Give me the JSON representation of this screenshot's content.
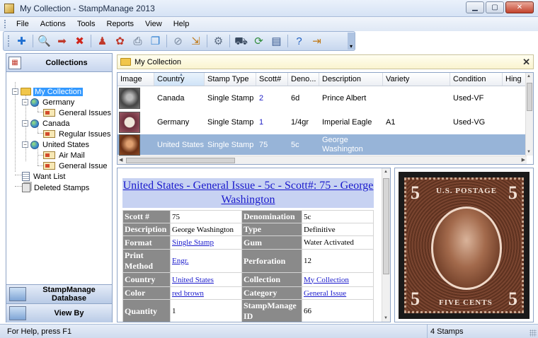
{
  "window": {
    "title": "My Collection - StampManage 2013"
  },
  "menu": [
    "File",
    "Actions",
    "Tools",
    "Reports",
    "View",
    "Help"
  ],
  "toolbar": {
    "buttons": [
      {
        "name": "add-stamp-icon",
        "glyph": "✚",
        "color": "#1f6fd1"
      },
      {
        "name": "find-icon",
        "glyph": "🔍",
        "color": "#b06b1a"
      },
      {
        "name": "export-icon",
        "glyph": "➡",
        "color": "#c0392b"
      },
      {
        "name": "delete-icon",
        "glyph": "✖",
        "color": "#d0251b"
      },
      {
        "name": "want-list-icon",
        "glyph": "♟",
        "color": "#c0392b"
      },
      {
        "name": "tools-icon",
        "glyph": "✿",
        "color": "#c0392b"
      },
      {
        "name": "print-icon",
        "glyph": "⎙",
        "color": "#4a5a70"
      },
      {
        "name": "copy-icon",
        "glyph": "❐",
        "color": "#2e7fd1"
      },
      {
        "name": "attach-icon",
        "glyph": "⊘",
        "color": "#7a8aa0"
      },
      {
        "name": "import-icon",
        "glyph": "⇲",
        "color": "#c07a1a"
      },
      {
        "name": "settings-icon",
        "glyph": "⚙",
        "color": "#5a6a80"
      },
      {
        "name": "cart-icon",
        "glyph": "⛟",
        "color": "#3a4a60"
      },
      {
        "name": "update-icon",
        "glyph": "⟳",
        "color": "#2e8b3a"
      },
      {
        "name": "report-icon",
        "glyph": "▤",
        "color": "#3a5a90"
      },
      {
        "name": "help-icon",
        "glyph": "?",
        "color": "#1f5fc1"
      },
      {
        "name": "exit-icon",
        "glyph": "⇥",
        "color": "#c07a1a"
      }
    ]
  },
  "left_panel": {
    "header": "Collections",
    "tree": {
      "root": "My Collection",
      "germany": "Germany",
      "germany_issue": "General Issues",
      "canada": "Canada",
      "canada_issue": "Regular Issues",
      "us": "United States",
      "us_air": "Air Mail",
      "us_general": "General Issue",
      "want_list": "Want List",
      "deleted": "Deleted Stamps"
    },
    "db_button": "StampManage Database",
    "viewby_button": "View By"
  },
  "breadcrumb": "My Collection",
  "grid": {
    "columns": [
      "Image",
      "Country",
      "Stamp Type",
      "Scott#",
      "Deno...",
      "Description",
      "Variety",
      "Condition",
      "Hing"
    ],
    "rows": [
      {
        "country": "Canada",
        "type": "Single Stamp",
        "scott": "2",
        "deno": "6d",
        "desc": "Prince Albert",
        "variety": "",
        "condition": "Used-VF"
      },
      {
        "country": "Germany",
        "type": "Single Stamp",
        "scott": "1",
        "deno": "1/4gr",
        "desc": "Imperial Eagle",
        "variety": "A1",
        "condition": "Used-VG"
      },
      {
        "country": "United States",
        "type": "Single Stamp",
        "scott": "75",
        "deno": "5c",
        "desc": "George Washington",
        "variety": "",
        "condition": ""
      }
    ]
  },
  "detail": {
    "title": "United States - General Issue - 5c - Scott#: 75 - George Washington",
    "fields": [
      {
        "k1": "Scott #",
        "v1": "75",
        "k2": "Denomination",
        "v2": "5c"
      },
      {
        "k1": "Description",
        "v1": "George Washington",
        "k2": "Type",
        "v2": "Definitive"
      },
      {
        "k1": "Format",
        "v1": "Single Stamp",
        "k2": "Gum",
        "v2": "Water Activated"
      },
      {
        "k1": "Print Method",
        "v1": "Engr.",
        "k2": "Perforation",
        "v2": "12"
      },
      {
        "k1": "Country",
        "v1": "United States",
        "k2": "Collection",
        "v2": "My Collection"
      },
      {
        "k1": "Color",
        "v1": "red brown",
        "k2": "Category",
        "v2": "General Issue"
      },
      {
        "k1": "Quantity",
        "v1": "1",
        "k2": "StampManage ID",
        "v2": "66"
      }
    ]
  },
  "stamp_image": {
    "top_text": "U.S. POSTAGE",
    "bottom_text": "FIVE CENTS",
    "numeral": "5"
  },
  "status": {
    "help": "For Help, press F1",
    "count": "4 Stamps"
  }
}
